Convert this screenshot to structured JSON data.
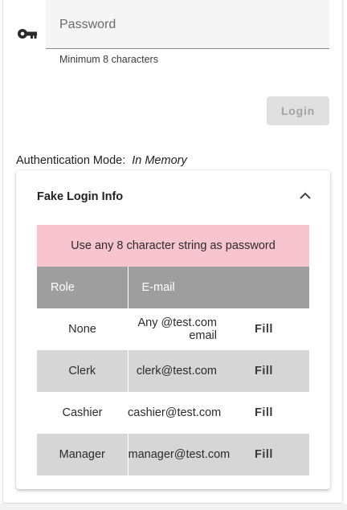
{
  "password": {
    "placeholder": "Password",
    "value": "",
    "hint": "Minimum 8 characters",
    "icon": "key-icon"
  },
  "login_button": {
    "label": "Login",
    "disabled": true
  },
  "auth": {
    "label": "Authentication Mode:",
    "value": "In Memory"
  },
  "fake_login": {
    "title": "Fake Login Info",
    "expanded": true,
    "banner": "Use any 8 character string as password",
    "banner_color": "#f8c4cd",
    "columns": [
      "Role",
      "E-mail"
    ],
    "rows": [
      {
        "role": "None",
        "email": "Any @test.com email",
        "action": "Fill"
      },
      {
        "role": "Clerk",
        "email": "clerk@test.com",
        "action": "Fill"
      },
      {
        "role": "Cashier",
        "email": "cashier@test.com",
        "action": "Fill"
      },
      {
        "role": "Manager",
        "email": "manager@test.com",
        "action": "Fill"
      }
    ]
  },
  "colors": {
    "header_bg": "#9e9e9e",
    "shaded_row_bg": "#d6d6d6",
    "button_disabled_bg": "#e0e0e0"
  }
}
